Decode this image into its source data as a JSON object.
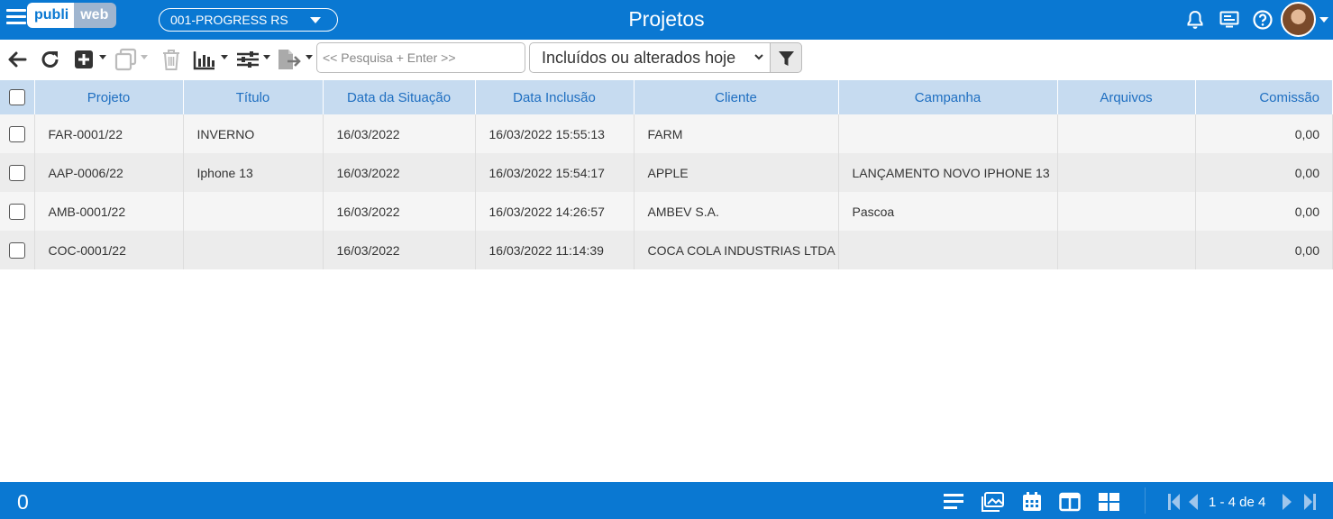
{
  "header": {
    "title": "Projetos",
    "logo_left": "publi",
    "logo_right": "web",
    "company": "001-PROGRESS RS"
  },
  "toolbar": {
    "search_placeholder": "<< Pesquisa + Enter >>",
    "filter_selected": "Incluídos ou alterados hoje"
  },
  "table": {
    "columns": [
      "Projeto",
      "Título",
      "Data da Situação",
      "Data Inclusão",
      "Cliente",
      "Campanha",
      "Arquivos",
      "Comissão"
    ],
    "rows": [
      {
        "projeto": "FAR-0001/22",
        "titulo": "INVERNO",
        "data_situacao": "16/03/2022",
        "data_inclusao": "16/03/2022 15:55:13",
        "cliente": "FARM",
        "campanha": "",
        "arquivos": "",
        "comissao": "0,00"
      },
      {
        "projeto": "AAP-0006/22",
        "titulo": "Iphone 13",
        "data_situacao": "16/03/2022",
        "data_inclusao": "16/03/2022 15:54:17",
        "cliente": "APPLE",
        "campanha": "LANÇAMENTO NOVO IPHONE 13",
        "arquivos": "",
        "comissao": "0,00"
      },
      {
        "projeto": "AMB-0001/22",
        "titulo": "",
        "data_situacao": "16/03/2022",
        "data_inclusao": "16/03/2022 14:26:57",
        "cliente": "AMBEV S.A.",
        "campanha": "Pascoa",
        "arquivos": "",
        "comissao": "0,00"
      },
      {
        "projeto": "COC-0001/22",
        "titulo": "",
        "data_situacao": "16/03/2022",
        "data_inclusao": "16/03/2022 11:14:39",
        "cliente": "COCA COLA INDUSTRIAS LTDA",
        "campanha": "",
        "arquivos": "",
        "comissao": "0,00"
      }
    ]
  },
  "footer": {
    "selected_count": "0",
    "pagination": "1 - 4 de 4"
  },
  "icons": {
    "menu": "menu-icon",
    "bell": "bell-icon",
    "monitor": "monitor-icon",
    "help": "help-icon",
    "back": "back-arrow-icon",
    "refresh": "refresh-icon",
    "add": "add-icon",
    "copy": "copy-icon",
    "delete": "trash-icon",
    "chart": "chart-icon",
    "adjust": "sliders-icon",
    "export": "export-icon",
    "filter": "filter-icon"
  },
  "colors": {
    "brand": "#0a78d2",
    "header_row": "#c6dbf0",
    "header_text": "#1f6fc1"
  }
}
